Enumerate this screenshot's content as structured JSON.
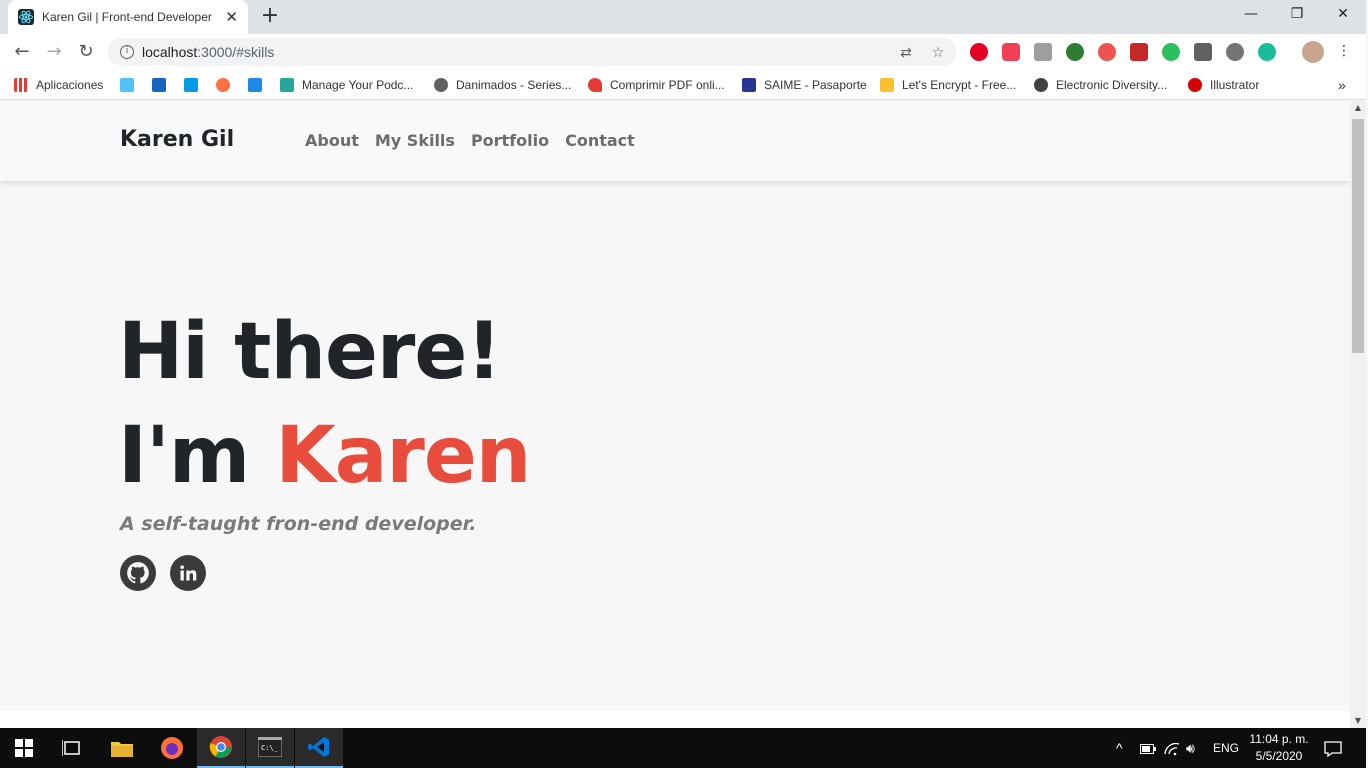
{
  "browser": {
    "tab_title": "Karen Gil | Front-end Developer",
    "tab_close": "✕",
    "new_tab": "+",
    "url_host": "localhost",
    "url_path": ":3000/#skills",
    "window_controls": {
      "minimize": "—",
      "restore": "❐",
      "close": "✕"
    },
    "nav": {
      "back": "←",
      "forward": "→",
      "reload": "↻"
    }
  },
  "bookmarks": [
    {
      "label": "Aplicaciones",
      "color": "#e53935"
    },
    {
      "label": "",
      "color": "#4fc3f7"
    },
    {
      "label": "",
      "color": "#1565c0"
    },
    {
      "label": "",
      "color": "#039be5"
    },
    {
      "label": "",
      "color": "#ff7043"
    },
    {
      "label": "",
      "color": "#1e88e5"
    },
    {
      "label": "Manage Your Podc...",
      "color": "#26a69a"
    },
    {
      "label": "Danimados - Series...",
      "color": "#616161"
    },
    {
      "label": "Comprimir PDF onli...",
      "color": "#e53935"
    },
    {
      "label": "SAIME - Pasaporte",
      "color": "#283593"
    },
    {
      "label": "Let's Encrypt - Free...",
      "color": "#fbc02d"
    },
    {
      "label": "Electronic Diversity...",
      "color": "#424242"
    },
    {
      "label": "Illustrator",
      "color": "#d50000"
    }
  ],
  "site": {
    "brand": "Karen Gil",
    "nav_links": [
      "About",
      "My Skills",
      "Portfolio",
      "Contact"
    ],
    "hero_line1": "Hi there!",
    "hero_im": "I'm ",
    "hero_name": "Karen",
    "tagline": "A self-taught fron-end developer.",
    "social": [
      "github-icon",
      "linkedin-icon"
    ],
    "accent_color": "#e74c3c"
  },
  "taskbar": {
    "language": "ENG",
    "time": "11:04 p. m.",
    "date": "5/5/2020"
  }
}
